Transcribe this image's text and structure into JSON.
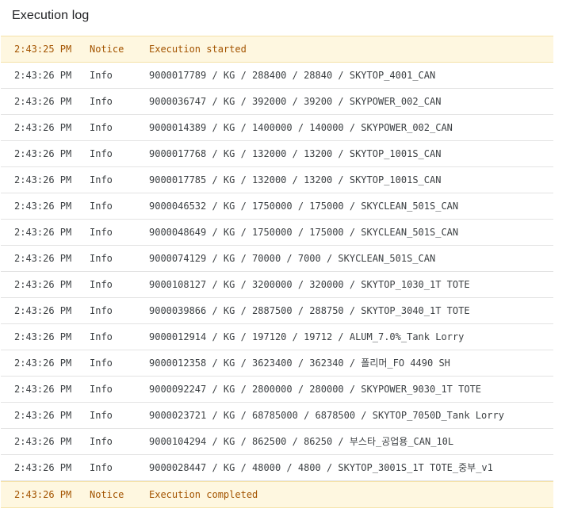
{
  "header": {
    "title": "Execution log"
  },
  "log": {
    "entries": [
      {
        "time": "2:43:25 PM",
        "level": "Notice",
        "message": "Execution started"
      },
      {
        "time": "2:43:26 PM",
        "level": "Info",
        "message": "9000017789 / KG / 288400 / 28840 / SKYTOP_4001_CAN"
      },
      {
        "time": "2:43:26 PM",
        "level": "Info",
        "message": "9000036747 / KG / 392000 / 39200 / SKYPOWER_002_CAN"
      },
      {
        "time": "2:43:26 PM",
        "level": "Info",
        "message": "9000014389 / KG / 1400000 / 140000 / SKYPOWER_002_CAN"
      },
      {
        "time": "2:43:26 PM",
        "level": "Info",
        "message": "9000017768 / KG / 132000 / 13200 / SKYTOP_1001S_CAN"
      },
      {
        "time": "2:43:26 PM",
        "level": "Info",
        "message": "9000017785 / KG / 132000 / 13200 / SKYTOP_1001S_CAN"
      },
      {
        "time": "2:43:26 PM",
        "level": "Info",
        "message": "9000046532 / KG / 1750000 / 175000 / SKYCLEAN_501S_CAN"
      },
      {
        "time": "2:43:26 PM",
        "level": "Info",
        "message": "9000048649 / KG / 1750000 / 175000 / SKYCLEAN_501S_CAN"
      },
      {
        "time": "2:43:26 PM",
        "level": "Info",
        "message": "9000074129 / KG / 70000 / 7000 / SKYCLEAN_501S_CAN"
      },
      {
        "time": "2:43:26 PM",
        "level": "Info",
        "message": "9000108127 / KG / 3200000 / 320000 / SKYTOP_1030_1T TOTE"
      },
      {
        "time": "2:43:26 PM",
        "level": "Info",
        "message": "9000039866 / KG / 2887500 / 288750 / SKYTOP_3040_1T TOTE"
      },
      {
        "time": "2:43:26 PM",
        "level": "Info",
        "message": "9000012914 / KG / 197120 / 19712 / ALUM_7.0%_Tank Lorry"
      },
      {
        "time": "2:43:26 PM",
        "level": "Info",
        "message": "9000012358 / KG / 3623400 / 362340 / 폴리머_FO 4490 SH"
      },
      {
        "time": "2:43:26 PM",
        "level": "Info",
        "message": "9000092247 / KG / 2800000 / 280000 / SKYPOWER_9030_1T TOTE"
      },
      {
        "time": "2:43:26 PM",
        "level": "Info",
        "message": "9000023721 / KG / 68785000 / 6878500 / SKYTOP_7050D_Tank Lorry"
      },
      {
        "time": "2:43:26 PM",
        "level": "Info",
        "message": "9000104294 / KG / 862500 / 86250 / 부스타_공업용_CAN_10L"
      },
      {
        "time": "2:43:26 PM",
        "level": "Info",
        "message": "9000028447 / KG / 48000 / 4800 / SKYTOP_3001S_1T TOTE_중부_v1"
      },
      {
        "time": "2:43:26 PM",
        "level": "Notice",
        "message": "Execution completed"
      }
    ]
  }
}
